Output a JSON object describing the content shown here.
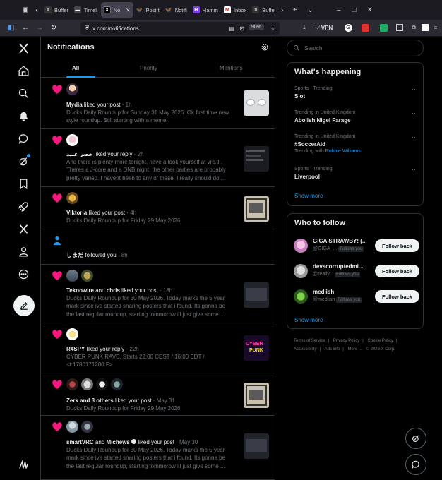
{
  "browser": {
    "tabs": [
      {
        "label": "Buffer",
        "fav": "#e7e9ea"
      },
      {
        "label": "Timeli",
        "fav": "#e7e9ea"
      },
      {
        "label": "No",
        "fav": "#000000",
        "active": true
      },
      {
        "label": "Post t",
        "fav": "#1d9bf0"
      },
      {
        "label": "Notifi",
        "fav": "#1d9bf0"
      },
      {
        "label": "Hamm",
        "fav": "#7b3fe4"
      },
      {
        "label": "Inbox",
        "fav": "#c5221f"
      },
      {
        "label": "Buffe",
        "fav": "#e7e9ea"
      }
    ],
    "url": "x.com/notifications",
    "zoom": "90%",
    "vpn_label": "VPN"
  },
  "header": {
    "title": "Notifications",
    "tabs": [
      "All",
      "Priority",
      "Mentions"
    ]
  },
  "notifications": [
    {
      "type": "like",
      "actor": "Mydia",
      "action": "liked your post",
      "time": "· 1h",
      "lines": [
        "Ducks Daily Roundup for Sunday 31 May 2026. Ok first time new",
        "style roundup. Still starting with a meme."
      ]
    },
    {
      "type": "like",
      "actor": "خضر عبيد",
      "action": "liked your reply",
      "time": "· 2h",
      "lines": [
        "And there is plenty more tonight, have a look yourself at vrc.tl .",
        "Theres a J-core and a DNB night, the other parties are probably",
        "pretty varied. I havent been to any of these. I really should do ..."
      ]
    },
    {
      "type": "like",
      "actor": "Viktoria",
      "action": "liked your post",
      "time": "· 4h",
      "lines": [
        "Ducks Daily Roundup for Friday 29 May 2026"
      ]
    },
    {
      "type": "follow",
      "actor": "しまだ",
      "action": "followed you",
      "time": "· 8h",
      "lines": []
    },
    {
      "type": "like",
      "actor": "Teknowire",
      "conj": "and",
      "actor2": "chris",
      "action": "liked your post",
      "time": "· 18h",
      "lines": [
        "Ducks Daily Roundup for 30 May 2026. Today marks the 5 year",
        "mark since ive started sharing posters that i found. Its gonna be",
        "the last regular roundup, starting tommorow ill just give some ..."
      ]
    },
    {
      "type": "like",
      "actor": "R4SPY",
      "action": "liked your reply",
      "time": "· 22h",
      "lines": [
        "CYBER PUNK RAVE. Starts 22:00 CEST / 16:00 EDT /",
        "<t:1780171200:F>"
      ]
    },
    {
      "type": "like",
      "actor": "Zerk",
      "conj": "and 3 others",
      "action": "liked your post",
      "time": "· May 31",
      "lines": [
        "Ducks Daily Roundup for Friday 29 May 2026"
      ]
    },
    {
      "type": "like",
      "actor": "smartVRC",
      "conj": "and",
      "actor2": "Michews",
      "action": "liked your post",
      "time": "· May 30",
      "lines": [
        "Ducks Daily Roundup for 30 May 2026. Today marks the 5 year",
        "mark since ive started sharing posters that i found. Its gonna be",
        "the last regular roundup, starting tommorow ill just give some ..."
      ]
    }
  ],
  "thumb_text": {
    "cyber": "CYBER",
    "punk": "PUNK"
  },
  "search": {
    "placeholder": "Search"
  },
  "trending": {
    "title": "What's happening",
    "items": [
      {
        "context": "Sports · Trending",
        "name": "Slot"
      },
      {
        "context": "Trending in United Kingdom",
        "name": "Abolish Nigel Farage"
      },
      {
        "context": "Trending in United Kingdom",
        "name": "#SoccerAid",
        "with_label": "Trending with",
        "with_link": "Robbie Williams"
      },
      {
        "context": "Sports · Trending",
        "name": "Liverpool"
      }
    ],
    "show_more": "Show more"
  },
  "who_to_follow": {
    "title": "Who to follow",
    "items": [
      {
        "name": "GIGA STRAWBY! (...",
        "handle": "@GIGA_...",
        "badge": "Follows you",
        "button": "Follow back"
      },
      {
        "name": "devscorruptedmi...",
        "handle": "@really...",
        "badge": "Follows you",
        "button": "Follow back"
      },
      {
        "name": "medlish",
        "handle": "@medlish",
        "badge": "Follows you",
        "button": "Follow back"
      }
    ],
    "show_more": "Show more"
  },
  "footer": {
    "links": [
      "Terms of Service",
      "|",
      "Privacy Policy",
      "|",
      "Cookie Policy",
      "|",
      "Accessibility",
      "|",
      "Ads info",
      "|",
      "More ...",
      "© 2026 X Corp."
    ]
  },
  "colors": {
    "accent": "#1d9bf0",
    "like": "#f91880",
    "border": "#2f3336",
    "muted": "#71767b"
  }
}
